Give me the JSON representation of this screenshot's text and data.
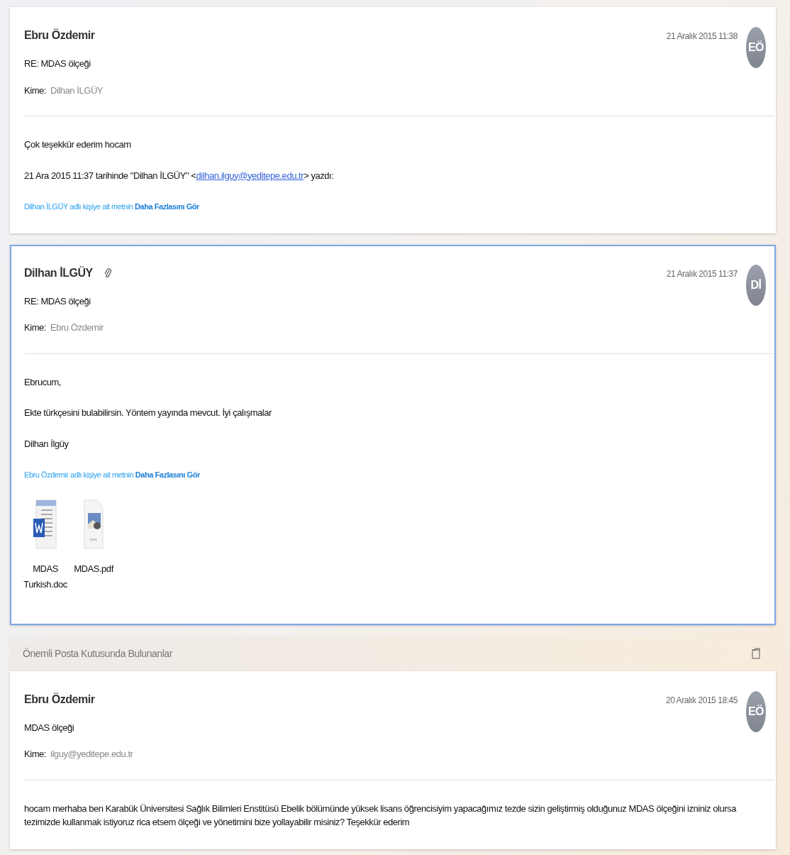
{
  "items": [
    {
      "kind": "message",
      "selected": false,
      "sender": "Ebru Özdemir",
      "has_attachment": false,
      "date": "21 Aralık 2015 11:38",
      "avatar": "EÖ",
      "subject": "RE: MDAS ölçeği",
      "to_label": "Kime:",
      "to": "Dilhan İLGÜY",
      "body": [
        {
          "kind": "text",
          "text": "Çok teşekkür ederim hocam"
        },
        {
          "kind": "quote_header",
          "before": "21 Ara 2015 11:37 tarihinde \"Dilhan İLGÜY\" <",
          "link": "dilhan.ilguy@yeditepe.edu.tr",
          "after": "> yazdı:"
        }
      ],
      "more": "Dilhan İLGÜY adlı kişiye ait metnin **Daha Fazlasını Gör**"
    },
    {
      "kind": "message",
      "selected": true,
      "sender": "Dilhan İLGÜY",
      "has_attachment": true,
      "date": "21 Aralık 2015 11:37",
      "avatar": "Dİ",
      "subject": "RE: MDAS ölçeği",
      "to_label": "Kime:",
      "to": "Ebru Özdemir",
      "body": [
        {
          "kind": "text",
          "text": "Ebrucum,"
        },
        {
          "kind": "text",
          "text": "Ekte türkçesini bulabilirsin. Yöntem yayında mevcut. İyi çalışmalar"
        },
        {
          "kind": "text",
          "text": "Dilhan İlgüy"
        }
      ],
      "more": "Ebru Özdemir adlı kişiye ait metnin **Daha Fazlasını Gör**",
      "attachments": [
        {
          "kind": "word",
          "name": "MDAS Turkish.doc"
        },
        {
          "kind": "pdf",
          "name": "MDAS.pdf"
        }
      ]
    },
    {
      "kind": "mailbox_header",
      "title": "Önemli Posta Kutusunda Bulunanlar"
    },
    {
      "kind": "message",
      "selected": false,
      "sender": "Ebru Özdemir",
      "has_attachment": false,
      "date": "20 Aralık 2015 18:45",
      "avatar": "EÖ",
      "subject": "MDAS ölçeği",
      "to_label": "Kime:",
      "to": "ilguy@yeditepe.edu.tr",
      "body": [
        {
          "kind": "text",
          "text": "hocam merhaba ben Karabük Üniversitesi Sağlık Bilimleri Enstitüsü Ebelik bölümünde yüksek lisans öğrencisiyim yapacağımız tezde sizin geliştirmiş olduğunuz MDAS ölçeğini izniniz olursa tezimizde kullanmak istiyoruz rica etsem ölçeği ve yönetimini  bize yollayabilir misiniz? Teşekkür ederim"
        }
      ]
    }
  ]
}
